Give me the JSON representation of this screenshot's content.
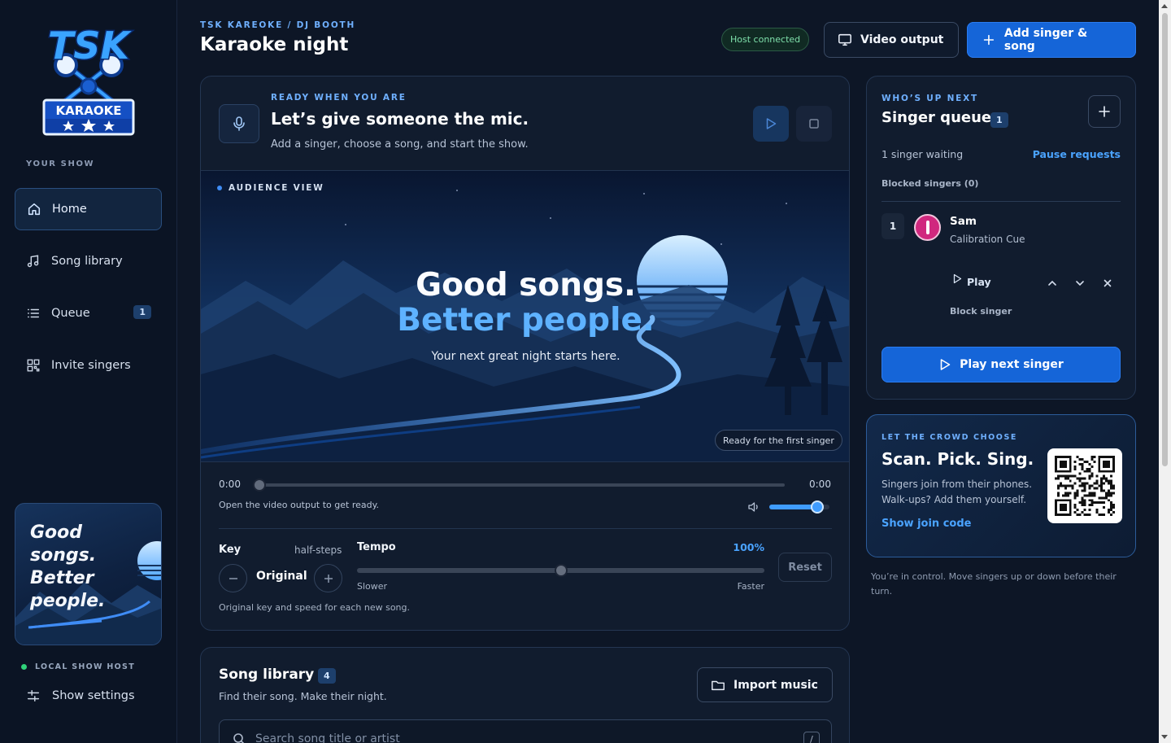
{
  "sidebar": {
    "logo": {
      "word1": "TSK",
      "word2": "KARAOKE"
    },
    "section_label": "YOUR SHOW",
    "items": [
      {
        "label": "Home",
        "icon": "home-icon",
        "active": true
      },
      {
        "label": "Song library",
        "icon": "music-note-icon"
      },
      {
        "label": "Queue",
        "icon": "list-icon",
        "badge": "1"
      },
      {
        "label": "Invite singers",
        "icon": "qr-code-icon"
      }
    ],
    "promo_text": "Good songs. Better people.",
    "host_status": "LOCAL SHOW HOST",
    "settings_label": "Show settings"
  },
  "header": {
    "breadcrumb": "TSK KAREOKE / DJ BOOTH",
    "title": "Karaoke night",
    "connection_status": "Host connected",
    "video_output_label": "Video output",
    "add_singer_label": "Add singer & song"
  },
  "now_playing": {
    "eyebrow": "READY WHEN YOU ARE",
    "headline": "Let’s give someone the mic.",
    "subtext": "Add a singer, choose a song, and start the show.",
    "audience_label": "AUDIENCE VIEW",
    "stage_line1": "Good songs.",
    "stage_line2": "Better people.",
    "stage_tagline": "Your next great night starts here.",
    "status_pill": "Ready for the first singer",
    "time_elapsed": "0:00",
    "time_total": "0:00",
    "progress": 0,
    "hint": "Open the video output to get ready.",
    "volume": 0.8
  },
  "controls": {
    "key_label": "Key",
    "key_unit": "half-steps",
    "key_value": "Original",
    "tempo_label": "Tempo",
    "tempo_value": "100%",
    "tempo_position": 0.5,
    "slower_label": "Slower",
    "faster_label": "Faster",
    "reset_label": "Reset",
    "note": "Original key and speed for each new song."
  },
  "library": {
    "title": "Song library",
    "count": "4",
    "subtitle": "Find their song. Make their night.",
    "import_label": "Import music",
    "search_placeholder": "Search song title or artist",
    "search_shortcut": "/"
  },
  "queue": {
    "eyebrow": "WHO’S UP NEXT",
    "title": "Singer queue",
    "count": "1",
    "waiting": "1 singer waiting",
    "pause_label": "Pause requests",
    "blocked_label": "Blocked singers (0)",
    "entries": [
      {
        "position": "1",
        "name": "Sam",
        "song": "Calibration Cue",
        "play_label": "Play",
        "block_label": "Block singer"
      }
    ],
    "play_next_label": "Play next singer"
  },
  "crowd": {
    "eyebrow": "LET THE CROWD CHOOSE",
    "title": "Scan. Pick. Sing.",
    "subtitle": "Singers join from their phones. Walk-ups? Add them yourself.",
    "link": "Show join code"
  },
  "footnote": "You’re in control. Move singers up or down before their turn.",
  "colors": {
    "accent": "#1565d8",
    "accent_text": "#4aa3ff",
    "background": "#0d1626",
    "card": "#111c2e",
    "success": "#2fd27a"
  }
}
